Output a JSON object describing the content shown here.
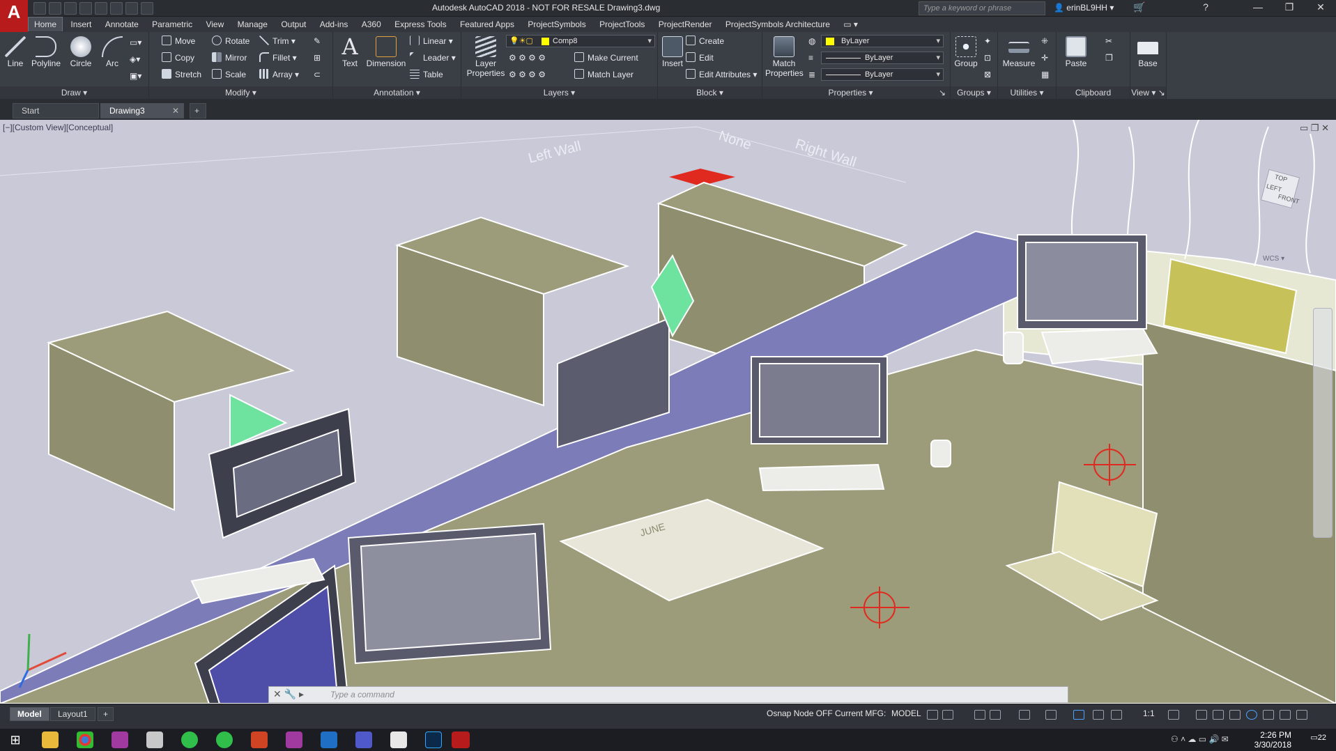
{
  "app": {
    "logo": "A",
    "window_title": "Autodesk AutoCAD 2018 - NOT FOR RESALE    Drawing3.dwg",
    "search_placeholder": "Type a keyword or phrase",
    "user": "erinBL9HH"
  },
  "menu": {
    "tabs": [
      "Home",
      "Insert",
      "Annotate",
      "Parametric",
      "View",
      "Manage",
      "Output",
      "Add-ins",
      "A360",
      "Express Tools",
      "Featured Apps",
      "ProjectSymbols",
      "ProjectTools",
      "ProjectRender",
      "ProjectSymbols Architecture"
    ],
    "active": "Home"
  },
  "ribbon": {
    "draw": {
      "title": "Draw",
      "line": "Line",
      "polyline": "Polyline",
      "circle": "Circle",
      "arc": "Arc"
    },
    "modify": {
      "title": "Modify",
      "move": "Move",
      "rotate": "Rotate",
      "trim": "Trim",
      "copy": "Copy",
      "mirror": "Mirror",
      "fillet": "Fillet",
      "stretch": "Stretch",
      "scale": "Scale",
      "array": "Array"
    },
    "annotation": {
      "title": "Annotation",
      "text": "Text",
      "dimension": "Dimension",
      "linear": "Linear",
      "leader": "Leader",
      "table": "Table"
    },
    "layers": {
      "title": "Layers",
      "layer_properties": "Layer Properties",
      "current_layer": "Comp8",
      "make_current": "Make Current",
      "match_layer": "Match Layer"
    },
    "block": {
      "title": "Block",
      "insert": "Insert",
      "create": "Create",
      "edit": "Edit",
      "edit_attributes": "Edit Attributes"
    },
    "properties": {
      "title": "Properties",
      "match_properties": "Match Properties",
      "color": "ByLayer",
      "linetype": "ByLayer",
      "lineweight": "ByLayer"
    },
    "groups": {
      "title": "Groups",
      "group": "Group"
    },
    "utilities": {
      "title": "Utilities",
      "measure": "Measure"
    },
    "clipboard": {
      "title": "Clipboard",
      "paste": "Paste"
    },
    "view": {
      "title": "View",
      "base": "Base"
    }
  },
  "doc_tabs": {
    "start": "Start",
    "drawing": "Drawing3",
    "add": "+"
  },
  "viewport": {
    "label": "[−][Custom View][Conceptual]",
    "wall_left": "Left Wall",
    "wall_right": "Right Wall",
    "wall_none": "None",
    "calendar_month": "JUNE",
    "viewcube_top": "TOP",
    "viewcube_left": "LEFT",
    "viewcube_front": "FRONT",
    "wcs": "WCS"
  },
  "command": {
    "placeholder": "Type a command"
  },
  "status": {
    "model_tab": "Model",
    "layout_tab": "Layout1",
    "add": "+",
    "osnap": "Osnap Node OFF",
    "current_mfg": "Current MFG:",
    "model": "MODEL",
    "scale": "1:1"
  },
  "taskbar": {
    "time": "2:26 PM",
    "date": "3/30/2018",
    "notifications": "22"
  },
  "colors": {
    "desk": "#9a9a78",
    "partition": "#7c7cb8",
    "background": "#c9c9d8",
    "accent_red": "#b81b1b",
    "monitor_green": "#6ee3a0",
    "yellow_monitor": "#c7c15a"
  }
}
